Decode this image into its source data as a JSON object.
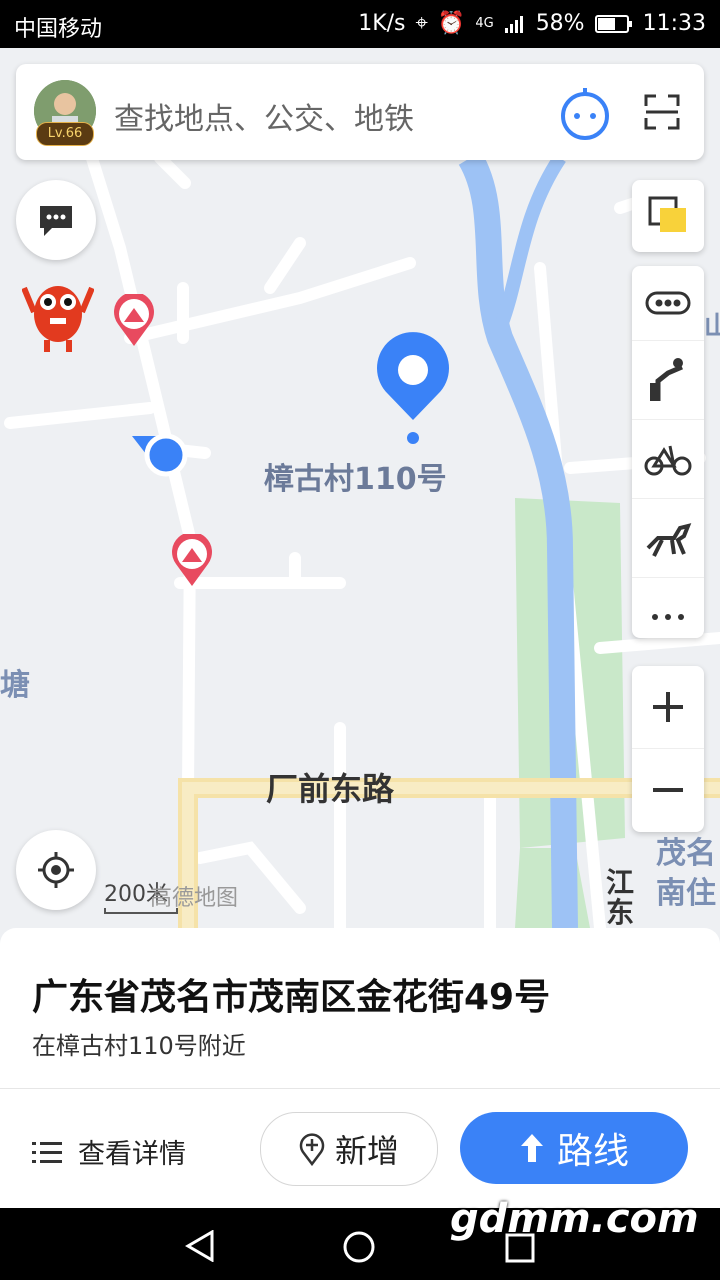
{
  "status_bar": {
    "carrier": "中国移动",
    "speed": "1K/s",
    "network": "4G",
    "battery": "58%",
    "time": "11:33"
  },
  "search": {
    "placeholder": "查找地点、公交、地铁",
    "level": "Lv.66"
  },
  "map": {
    "labels": {
      "pin_label": "樟古村110号",
      "road_label": "厂前东路",
      "left_partial": "塘",
      "right_partial_1": "茂名",
      "right_partial_2": "南住",
      "right_partial_3": "江东",
      "top_right_partial": "山"
    },
    "scale": "200米",
    "brand": "高德地图"
  },
  "side_toolbar": {
    "items": [
      "layers-icon",
      "traffic-icon",
      "walk-icon",
      "bike-icon",
      "ride-icon",
      "more-icon"
    ]
  },
  "place_card": {
    "address": "广东省茂名市茂南区金花街49号",
    "nearby": "在樟古村110号附近",
    "details_label": "查看详情",
    "add_label": "新增",
    "route_label": "路线"
  },
  "watermark": "gdmm.com",
  "colors": {
    "accent": "#3a82f7",
    "river": "#9dc2f5",
    "park": "#c9e8c9",
    "main_road": "#f5e2a8"
  }
}
